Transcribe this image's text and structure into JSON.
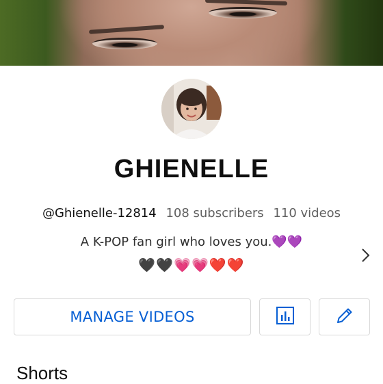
{
  "channel": {
    "name": "GHIENELLE",
    "handle": "@Ghienelle-12814",
    "subscribers": "108 subscribers",
    "videos": "110 videos",
    "description_line1": "A K-POP fan girl who loves you.",
    "description_hearts_line1": "💜💜",
    "description_line2": "🖤🖤💗💗❤️❤️"
  },
  "actions": {
    "manage_videos_label": "MANAGE VIDEOS"
  },
  "icons": {
    "analytics": "analytics-icon",
    "edit": "pencil-icon",
    "more": "chevron-right-icon"
  },
  "sections": {
    "shorts_title": "Shorts"
  },
  "colors": {
    "accent_blue": "#065fd4",
    "heart_purple": "#7b3fd0",
    "border": "#d9d9d9"
  }
}
